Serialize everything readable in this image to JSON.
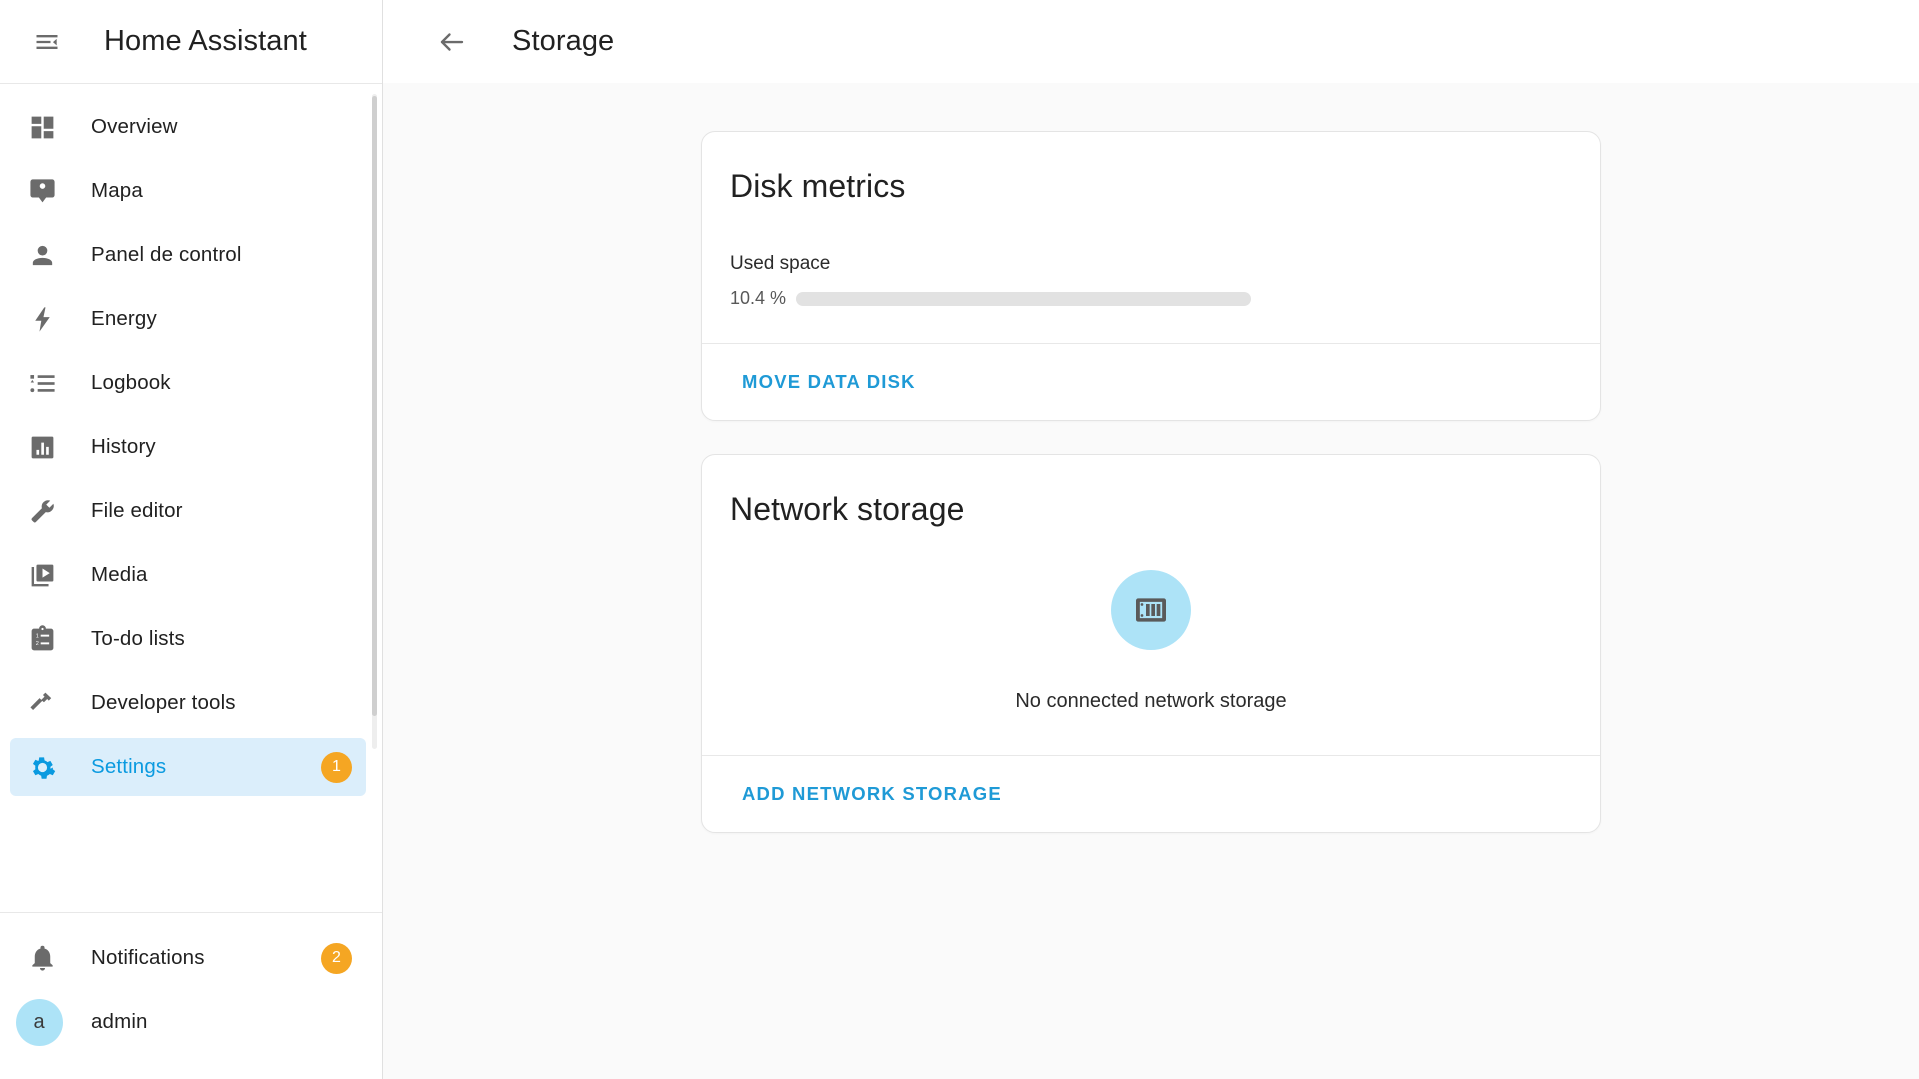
{
  "sidebar": {
    "title": "Home Assistant",
    "menu_icon": "menu-collapse-icon",
    "items": [
      {
        "label": "Overview",
        "icon": "view-dashboard-icon",
        "active": false,
        "badge": null
      },
      {
        "label": "Mapa",
        "icon": "map-marker-account-icon",
        "active": false,
        "badge": null
      },
      {
        "label": "Panel de control",
        "icon": "account-icon",
        "active": false,
        "badge": null
      },
      {
        "label": "Energy",
        "icon": "lightning-bolt-icon",
        "active": false,
        "badge": null
      },
      {
        "label": "Logbook",
        "icon": "format-list-bulleted-icon",
        "active": false,
        "badge": null
      },
      {
        "label": "History",
        "icon": "chart-box-icon",
        "active": false,
        "badge": null
      },
      {
        "label": "File editor",
        "icon": "wrench-icon",
        "active": false,
        "badge": null
      },
      {
        "label": "Media",
        "icon": "play-box-multiple-icon",
        "active": false,
        "badge": null
      },
      {
        "label": "To-do lists",
        "icon": "clipboard-list-icon",
        "active": false,
        "badge": null
      },
      {
        "label": "Developer tools",
        "icon": "hammer-icon",
        "active": false,
        "badge": null
      },
      {
        "label": "Settings",
        "icon": "cog-icon",
        "active": true,
        "badge": "1"
      }
    ],
    "footer": {
      "notifications": {
        "label": "Notifications",
        "icon": "bell-icon",
        "badge": "2"
      },
      "user": {
        "label": "admin",
        "initial": "a"
      }
    }
  },
  "toolbar": {
    "back_icon": "arrow-left-icon",
    "title": "Storage"
  },
  "cards": {
    "disk_metrics": {
      "title": "Disk metrics",
      "metric_label": "Used space",
      "metric_value": "10.4 %",
      "metric_percent": 10.4,
      "action_label": "MOVE DATA DISK"
    },
    "network_storage": {
      "title": "Network storage",
      "empty_icon": "nas-icon",
      "empty_text": "No connected network storage",
      "action_label": "ADD NETWORK STORAGE"
    }
  },
  "colors": {
    "accent": "#1f9ad6",
    "active_bg": "#dbeefb",
    "badge": "#f5a623",
    "progress": "#43a047",
    "avatar_bg": "#ade3f7"
  }
}
